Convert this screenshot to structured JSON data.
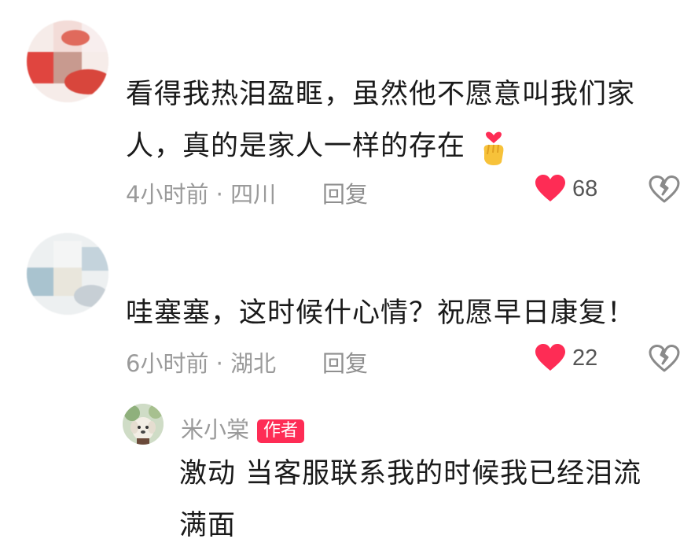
{
  "comments": [
    {
      "username": "",
      "text_line1": "看得我热泪盈眶，虽然他不愿意叫我们家",
      "text_line2": "人，真的是家人一样的存在",
      "emoji": "finger-heart",
      "time_location": "4小时前 · 四川",
      "reply_label": "回复",
      "likes": "68"
    },
    {
      "username": "",
      "text_line1": "哇塞塞，这时候什心情？祝愿早日康复！",
      "time_location": "6小时前 · 湖北",
      "reply_label": "回复",
      "likes": "22"
    }
  ],
  "reply": {
    "username": "米小棠",
    "badge": "作者",
    "text_line1": "激动 当客服联系我的时候我已经泪流",
    "text_line2": "满面"
  },
  "colors": {
    "like_heart": "#fe2c55",
    "badge_bg": "#fe2c55"
  }
}
